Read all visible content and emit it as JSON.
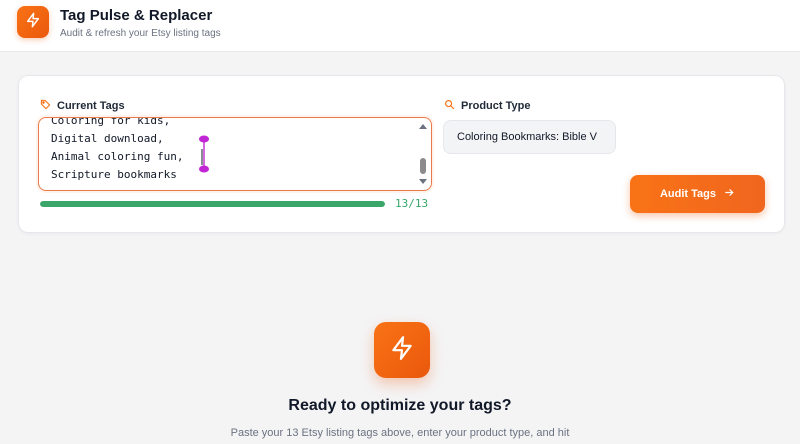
{
  "header": {
    "title": "Tag Pulse & Replacer",
    "subtitle": "Audit & refresh your Etsy listing tags",
    "logo_icon": "lightning-icon"
  },
  "form": {
    "tags_label": "Current Tags",
    "tags_icon": "tag-icon",
    "tag_lines": [
      "Coloring for kids,",
      "Digital download,",
      "Animal coloring fun,",
      "Scripture bookmarks"
    ],
    "tag_progress": 1.0,
    "tag_count": "13/13",
    "product_type_label": "Product Type",
    "product_type_icon": "search-icon",
    "product_type_value": "Coloring Bookmarks: Bible V",
    "audit_button_label": "Audit Tags",
    "audit_button_icon": "arrow-right-icon"
  },
  "empty_state": {
    "icon": "lightning-icon",
    "title": "Ready to optimize your tags?",
    "description": "Paste your 13 Etsy listing tags above, enter your product type, and hit"
  },
  "colors": {
    "accent": "#f97316",
    "accent_dark": "#ea580c",
    "progress": "#3aa66a"
  }
}
